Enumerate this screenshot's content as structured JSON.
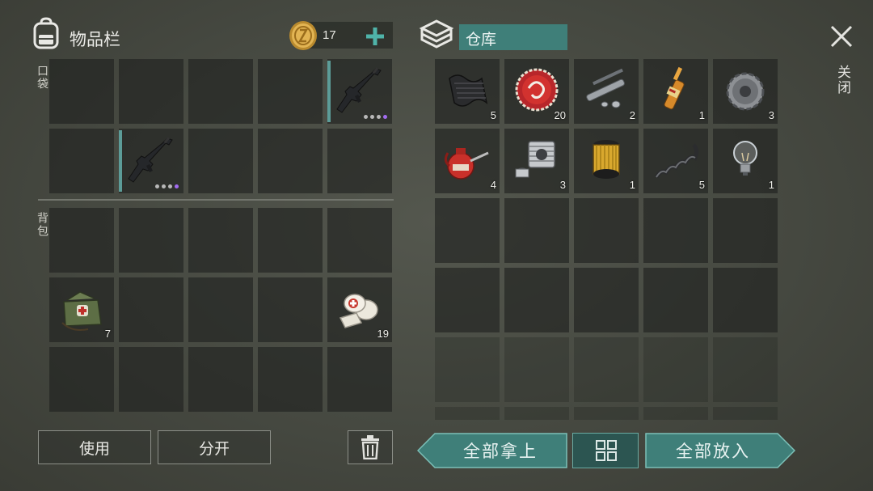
{
  "inventory": {
    "title": "物品栏",
    "coins": "17",
    "pocket_label": "口袋",
    "backpack_label": "背包",
    "pocket_items": [
      {
        "slot": 4,
        "icon": "rifle-icon",
        "count": ""
      },
      {
        "slot": 6,
        "icon": "rifle-icon",
        "count": ""
      }
    ],
    "backpack_items": [
      {
        "slot": 5,
        "icon": "medkit-bag-icon",
        "count": "7"
      },
      {
        "slot": 9,
        "icon": "bandage-icon",
        "count": "19"
      }
    ]
  },
  "storage": {
    "title": "仓库",
    "items": [
      {
        "icon": "carbon-fabric-icon",
        "count": "5"
      },
      {
        "icon": "bottle-cap-icon",
        "count": "20"
      },
      {
        "icon": "pipe-parts-icon",
        "count": "2"
      },
      {
        "icon": "ampoule-icon",
        "count": "1"
      },
      {
        "icon": "gear-icon",
        "count": "3"
      },
      {
        "icon": "oil-can-icon",
        "count": "4"
      },
      {
        "icon": "engine-cylinder-icon",
        "count": "3"
      },
      {
        "icon": "oil-filter-icon",
        "count": "1"
      },
      {
        "icon": "spring-icon",
        "count": "5"
      },
      {
        "icon": "light-bulb-icon",
        "count": "1"
      }
    ]
  },
  "buttons": {
    "use": "使用",
    "split": "分开",
    "take_all": "全部拿上",
    "put_all": "全部放入",
    "close": "关闭"
  },
  "colors": {
    "accent_teal": "#3f7f79",
    "rarity_purple": "#a26cf0"
  }
}
